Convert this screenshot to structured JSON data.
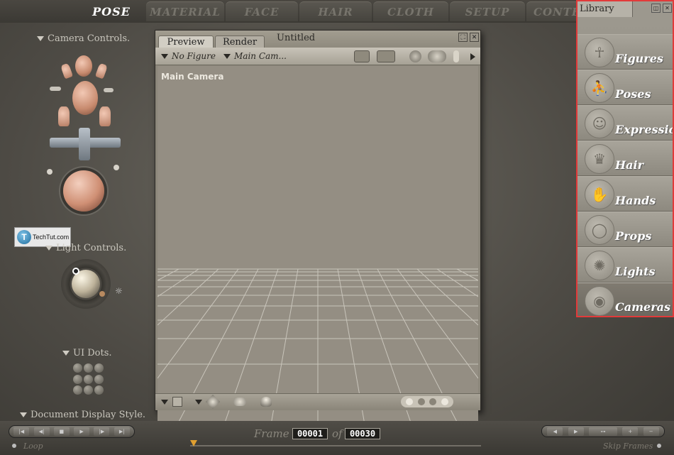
{
  "tabs": [
    {
      "label": "POSE",
      "active": true
    },
    {
      "label": "MATERIAL",
      "active": false
    },
    {
      "label": "FACE",
      "active": false
    },
    {
      "label": "HAIR",
      "active": false
    },
    {
      "label": "CLOTH",
      "active": false
    },
    {
      "label": "SETUP",
      "active": false
    },
    {
      "label": "CONTENT",
      "active": false
    }
  ],
  "left_panel": {
    "camera_controls": "Camera Controls.",
    "light_controls": "Light Controls.",
    "ui_dots": "UI Dots.",
    "document_display_style": "Document Display Style."
  },
  "watermark": {
    "logo_letter": "T",
    "text": "TechTut.com"
  },
  "document": {
    "tabs": [
      "Preview",
      "Render"
    ],
    "title": "Untitled",
    "figure_dropdown": "No Figure",
    "camera_dropdown": "Main Cam...",
    "viewport_label": "Main Camera"
  },
  "library": {
    "tab": "Library",
    "items": [
      {
        "label": "Figures",
        "icon": "figure-icon"
      },
      {
        "label": "Poses",
        "icon": "running-man-icon"
      },
      {
        "label": "Expression",
        "icon": "face-icon"
      },
      {
        "label": "Hair",
        "icon": "hair-icon"
      },
      {
        "label": "Hands",
        "icon": "hand-icon"
      },
      {
        "label": "Props",
        "icon": "ring-icon"
      },
      {
        "label": "Lights",
        "icon": "lightbulb-icon"
      },
      {
        "label": "Cameras",
        "icon": "camera-icon"
      }
    ],
    "selected": "Cameras",
    "border_color": "#e23a3a"
  },
  "timeline": {
    "frame_label": "Frame",
    "current_frame": "00001",
    "of_label": "of",
    "total_frames": "00030",
    "loop_label": "Loop",
    "skip_frames_label": "Skip Frames"
  }
}
